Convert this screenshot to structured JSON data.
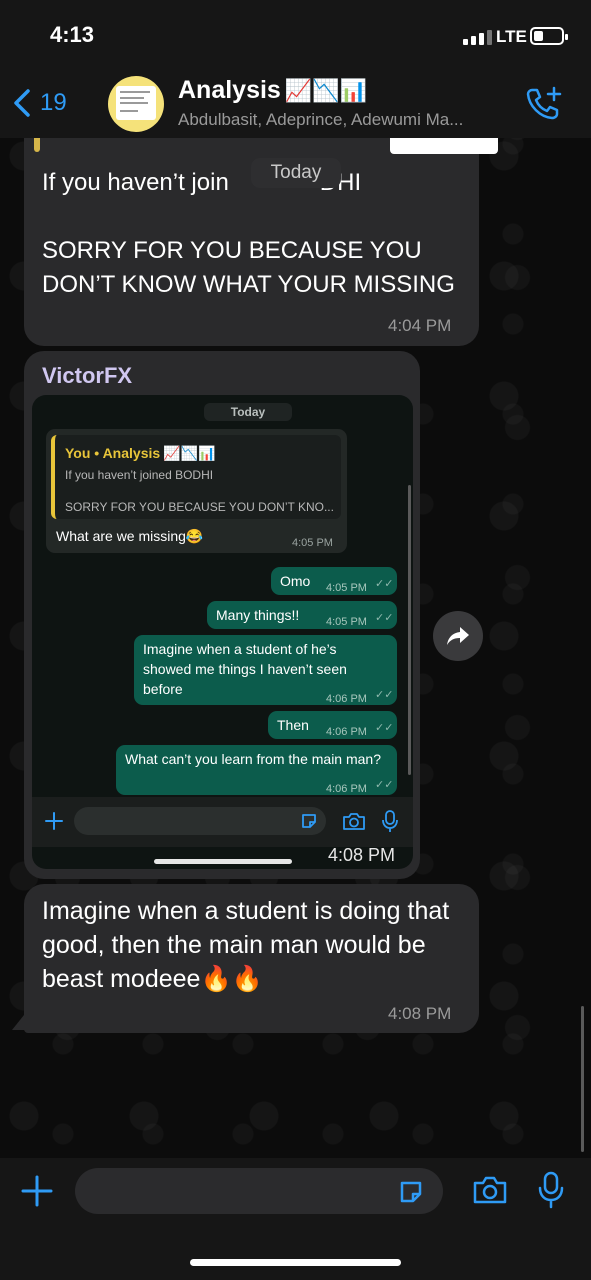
{
  "status_bar": {
    "time": "4:13",
    "network": "LTE"
  },
  "header": {
    "back_count": "19",
    "group_name": "Analysis",
    "group_emojis": "📈📉📊",
    "members": "Abdulbasit, Adeprince, Adewumi Ma..."
  },
  "date_pill": "Today",
  "messages": [
    {
      "text": "If you haven’t joined BODHI\n\nSORRY FOR YOU BECAUSE YOU DON’T KNOW WHAT YOUR MISSING",
      "visible_head": "If you haven’t join",
      "visible_tail": "DHI",
      "visible_body": "SORRY FOR YOU BECAUSE YOU DON’T KNOW WHAT YOUR MISSING",
      "time": "4:04 PM"
    },
    {
      "sender": "VictorFX",
      "time": "4:08 PM",
      "screenshot": {
        "date": "Today",
        "quote": {
          "title": "You • Analysis",
          "line1": "If you haven’t joined BODHI",
          "line2": "SORRY FOR YOU BECAUSE YOU DON’T KNO..."
        },
        "reply_text": "What are we missing😂",
        "reply_time": "4:05 PM",
        "outgoing": [
          {
            "text": "Omo",
            "time": "4:05 PM"
          },
          {
            "text": "Many things!!",
            "time": "4:05 PM"
          },
          {
            "text": "Imagine when a student of he’s showed me things I haven’t seen before",
            "time": "4:06 PM"
          },
          {
            "text": "Then",
            "time": "4:06 PM"
          },
          {
            "text": "What can’t you learn from the main man?",
            "time": "4:06 PM"
          }
        ]
      }
    },
    {
      "text": "Imagine when a student is doing that good, then the main man would be beast modeee🔥🔥",
      "time": "4:08 PM"
    }
  ],
  "colors": {
    "accent": "#2f9bf5",
    "bubble": "#2a2a2c",
    "outgoing": "#0c5c4c",
    "quote_bar": "#e8c53a"
  }
}
